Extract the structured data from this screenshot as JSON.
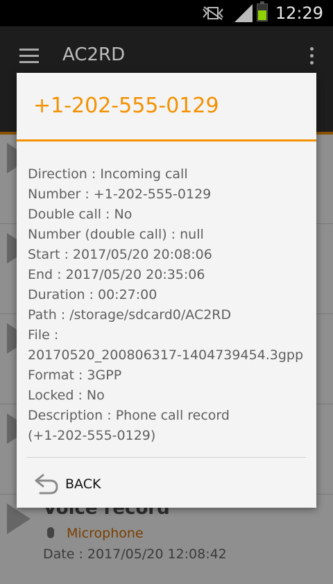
{
  "status_bar": {
    "time": "12:29",
    "battery_level": 0.6
  },
  "app_bar": {
    "title": "AC2RD"
  },
  "background_list": {
    "last_item": {
      "title": "Voice record",
      "source": "Microphone",
      "date": "Date : 2017/05/20 12:08:42"
    }
  },
  "dialog": {
    "title": "+1-202-555-0129",
    "details": {
      "direction": "Direction : Incoming call",
      "number": "Number : +1-202-555-0129",
      "double_call": "Double call : No",
      "number_double_call": "Number (double call) : null",
      "start": "Start : 2017/05/20 20:08:06",
      "end": "End : 2017/05/20 20:35:06",
      "duration": "Duration : 00:27:00",
      "path": "Path : /storage/sdcard0/AC2RD",
      "file_label": "File :",
      "file_value": "20170520_200806317-1404739454.3gpp",
      "format": "Format : 3GPP",
      "locked": "Locked : No",
      "description_label": "Description : Phone call record",
      "description_value": "(+1-202-555-0129)"
    },
    "back_label": "BACK"
  },
  "colors": {
    "accent": "#f39100",
    "dialog_bg": "#f4f4f4",
    "text": "#5f5f5f"
  }
}
